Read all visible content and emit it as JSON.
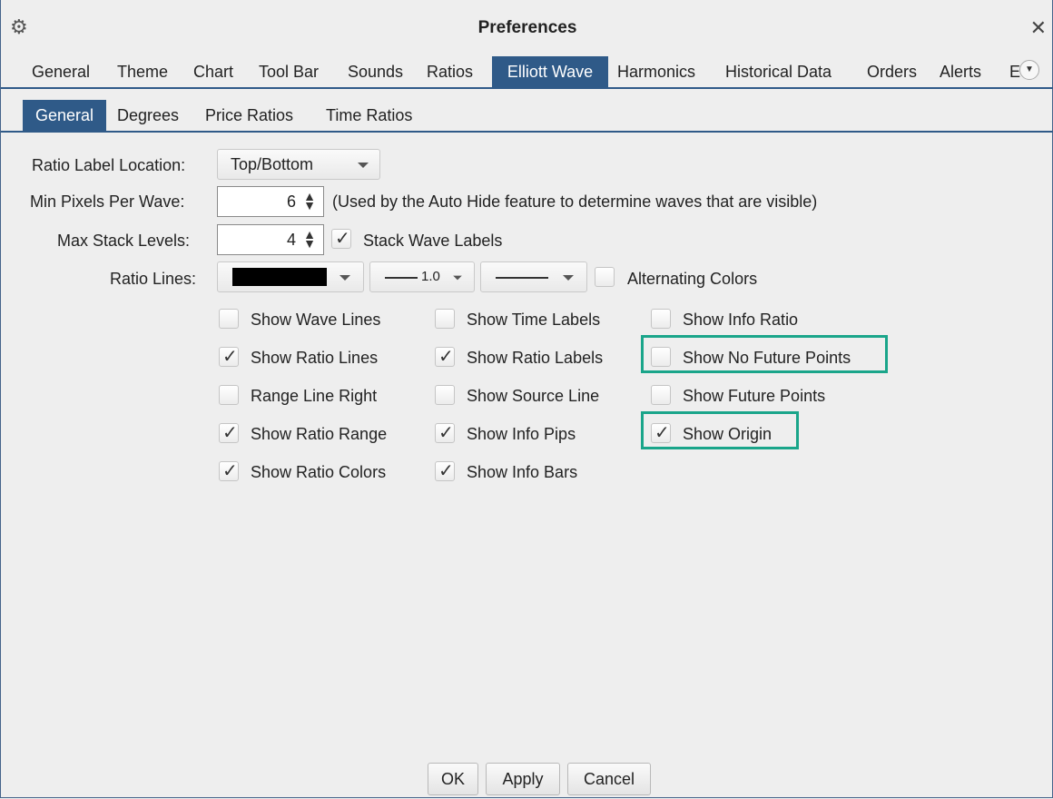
{
  "window": {
    "title": "Preferences"
  },
  "main_tabs": [
    {
      "label": "General"
    },
    {
      "label": "Theme"
    },
    {
      "label": "Chart"
    },
    {
      "label": "Tool Bar"
    },
    {
      "label": "Sounds"
    },
    {
      "label": "Ratios"
    },
    {
      "label": "Elliott Wave",
      "active": true
    },
    {
      "label": "Harmonics"
    },
    {
      "label": "Historical Data"
    },
    {
      "label": "Orders"
    },
    {
      "label": "Alerts"
    },
    {
      "label": "E"
    }
  ],
  "sub_tabs": [
    {
      "label": "General",
      "active": true
    },
    {
      "label": "Degrees"
    },
    {
      "label": "Price Ratios"
    },
    {
      "label": "Time Ratios"
    }
  ],
  "form": {
    "ratio_label_location": {
      "label": "Ratio Label Location:",
      "value": "Top/Bottom"
    },
    "min_pixels_per_wave": {
      "label": "Min Pixels Per Wave:",
      "value": "6",
      "note": "(Used by the Auto Hide feature to determine waves that are visible)"
    },
    "max_stack_levels": {
      "label": "Max Stack Levels:",
      "value": "4"
    },
    "stack_wave_labels": {
      "label": "Stack Wave Labels",
      "checked": true
    },
    "ratio_lines": {
      "label": "Ratio Lines:",
      "color": "#000000",
      "width_value": "1.0"
    },
    "alternating_colors": {
      "label": "Alternating Colors",
      "checked": false
    }
  },
  "options": {
    "show_wave_lines": {
      "label": "Show Wave Lines",
      "checked": false
    },
    "show_time_labels": {
      "label": "Show Time Labels",
      "checked": false
    },
    "show_info_ratio": {
      "label": "Show Info Ratio",
      "checked": false
    },
    "show_ratio_lines": {
      "label": "Show Ratio Lines",
      "checked": true
    },
    "show_ratio_labels": {
      "label": "Show Ratio Labels",
      "checked": true
    },
    "show_no_future_points": {
      "label": "Show No Future Points",
      "checked": false
    },
    "range_line_right": {
      "label": "Range Line Right",
      "checked": false
    },
    "show_source_line": {
      "label": "Show Source Line",
      "checked": false
    },
    "show_future_points": {
      "label": "Show Future Points",
      "checked": false
    },
    "show_ratio_range": {
      "label": "Show Ratio Range",
      "checked": true
    },
    "show_info_pips": {
      "label": "Show Info Pips",
      "checked": true
    },
    "show_origin": {
      "label": "Show Origin",
      "checked": true
    },
    "show_ratio_colors": {
      "label": "Show Ratio Colors",
      "checked": true
    },
    "show_info_bars": {
      "label": "Show Info Bars",
      "checked": true
    }
  },
  "buttons": {
    "ok": "OK",
    "apply": "Apply",
    "cancel": "Cancel"
  },
  "colors": {
    "accent": "#2f5a88",
    "highlight": "#1aa58a"
  },
  "icons": {
    "check": "✓"
  }
}
